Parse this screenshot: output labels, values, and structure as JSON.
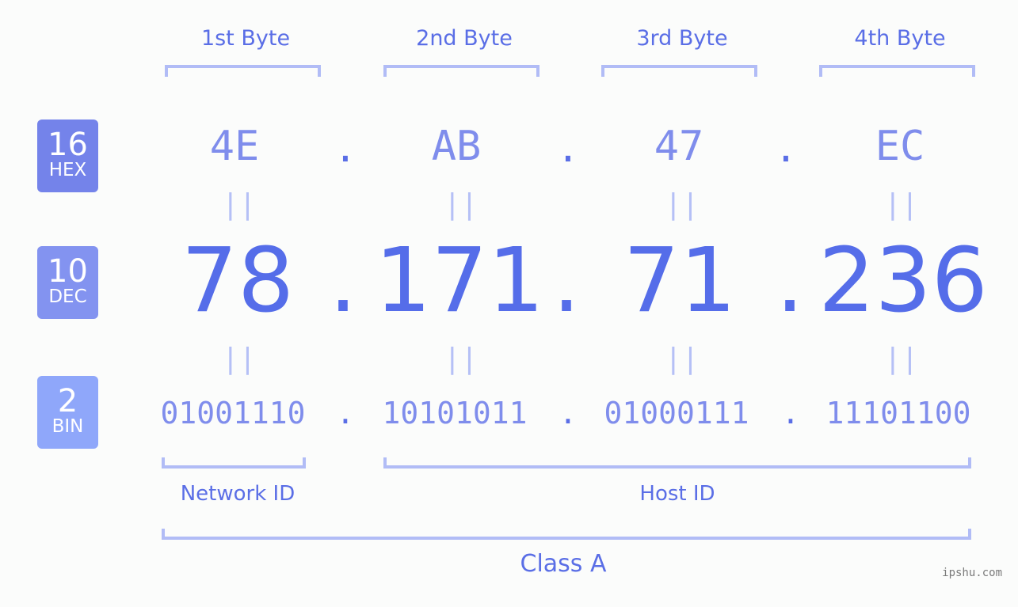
{
  "headers": [
    "1st Byte",
    "2nd Byte",
    "3rd Byte",
    "4th Byte"
  ],
  "badges": [
    {
      "number": "16",
      "label": "HEX",
      "color": "#7483ea"
    },
    {
      "number": "10",
      "label": "DEC",
      "color": "#8393f0"
    },
    {
      "number": "2",
      "label": "BIN",
      "color": "#8fa7fa"
    }
  ],
  "hex": [
    "4E",
    "AB",
    "47",
    "EC"
  ],
  "dec": [
    "78",
    "171",
    "71",
    "236"
  ],
  "bin": [
    "01001110",
    "10101011",
    "01000111",
    "11101100"
  ],
  "separator": ".",
  "equals": "||",
  "network_id_label": "Network ID",
  "host_id_label": "Host ID",
  "class_label": "Class A",
  "watermark": "ipshu.com",
  "colors": {
    "accent": "#556de9",
    "bracket": "#b1bcf6",
    "hex_text": "#7f8dec"
  }
}
